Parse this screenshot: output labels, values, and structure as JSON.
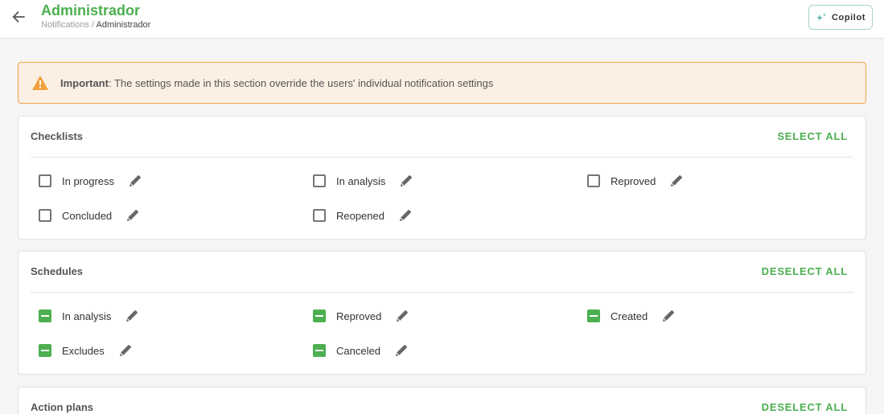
{
  "header": {
    "title": "Administrador",
    "breadcrumb_parent": "Notifications /",
    "breadcrumb_current": "Administrador",
    "copilot_label": "Copilot"
  },
  "alert": {
    "strong": "Important",
    "message": ": The settings made in this section override the users' individual notification settings"
  },
  "sections": {
    "checklists": {
      "title": "Checklists",
      "action": "SELECT ALL",
      "items": [
        {
          "label": "In progress",
          "checked": false
        },
        {
          "label": "In analysis",
          "checked": false
        },
        {
          "label": "Reproved",
          "checked": false
        },
        {
          "label": "Concluded",
          "checked": false
        },
        {
          "label": "Reopened",
          "checked": false
        }
      ]
    },
    "schedules": {
      "title": "Schedules",
      "action": "DESELECT ALL",
      "items": [
        {
          "label": "In analysis",
          "checked": true
        },
        {
          "label": "Reproved",
          "checked": true
        },
        {
          "label": "Created",
          "checked": true
        },
        {
          "label": "Excludes",
          "checked": true
        },
        {
          "label": "Canceled",
          "checked": true
        }
      ]
    },
    "action_plans": {
      "title": "Action plans",
      "action": "DESELECT ALL"
    }
  },
  "colors": {
    "accent": "#4caf50",
    "alert_bg": "#fcefe3",
    "alert_border": "#f2a64a",
    "warning_icon": "#f2a03d"
  }
}
